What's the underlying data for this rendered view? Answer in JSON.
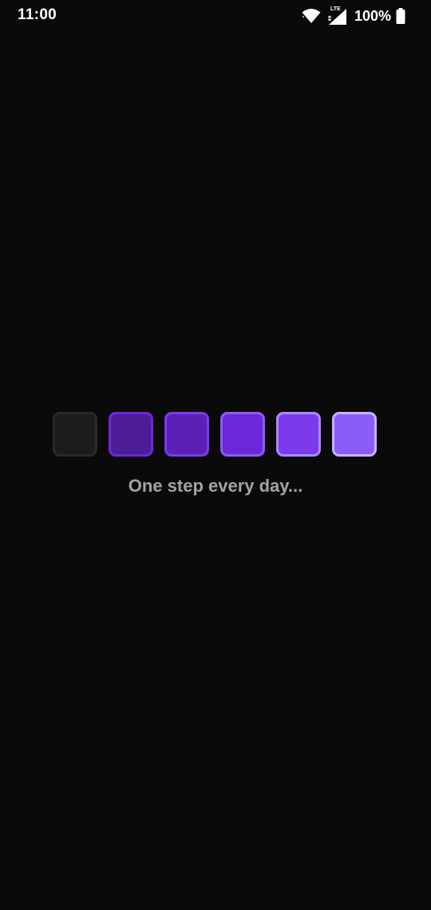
{
  "status_bar": {
    "time": "11:00",
    "network": "LTE",
    "battery_percent": "100%"
  },
  "loader": {
    "caption": "One step every day...",
    "squares": [
      {
        "fill": "#1c1c1f",
        "border": "#2a2a2e"
      },
      {
        "fill": "#4c1d95",
        "border": "#6d28d9"
      },
      {
        "fill": "#5b21b6",
        "border": "#7c3aed"
      },
      {
        "fill": "#6d28d9",
        "border": "#8b5cf6"
      },
      {
        "fill": "#7c3aed",
        "border": "#a78bfa"
      },
      {
        "fill": "#8b5cf6",
        "border": "#c4b5fd"
      }
    ]
  },
  "colors": {
    "background": "#0a0a0a",
    "caption": "#a3a3a3"
  }
}
